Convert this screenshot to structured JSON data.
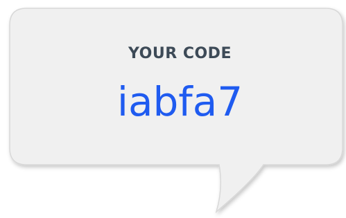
{
  "bubble": {
    "label": "YOUR CODE",
    "code": "iabfa7"
  },
  "colors": {
    "bubble_fill": "#f0f0f0",
    "bubble_border": "#d8d8d8",
    "label_color": "#3d4a57",
    "code_color": "#1f5bf0"
  }
}
